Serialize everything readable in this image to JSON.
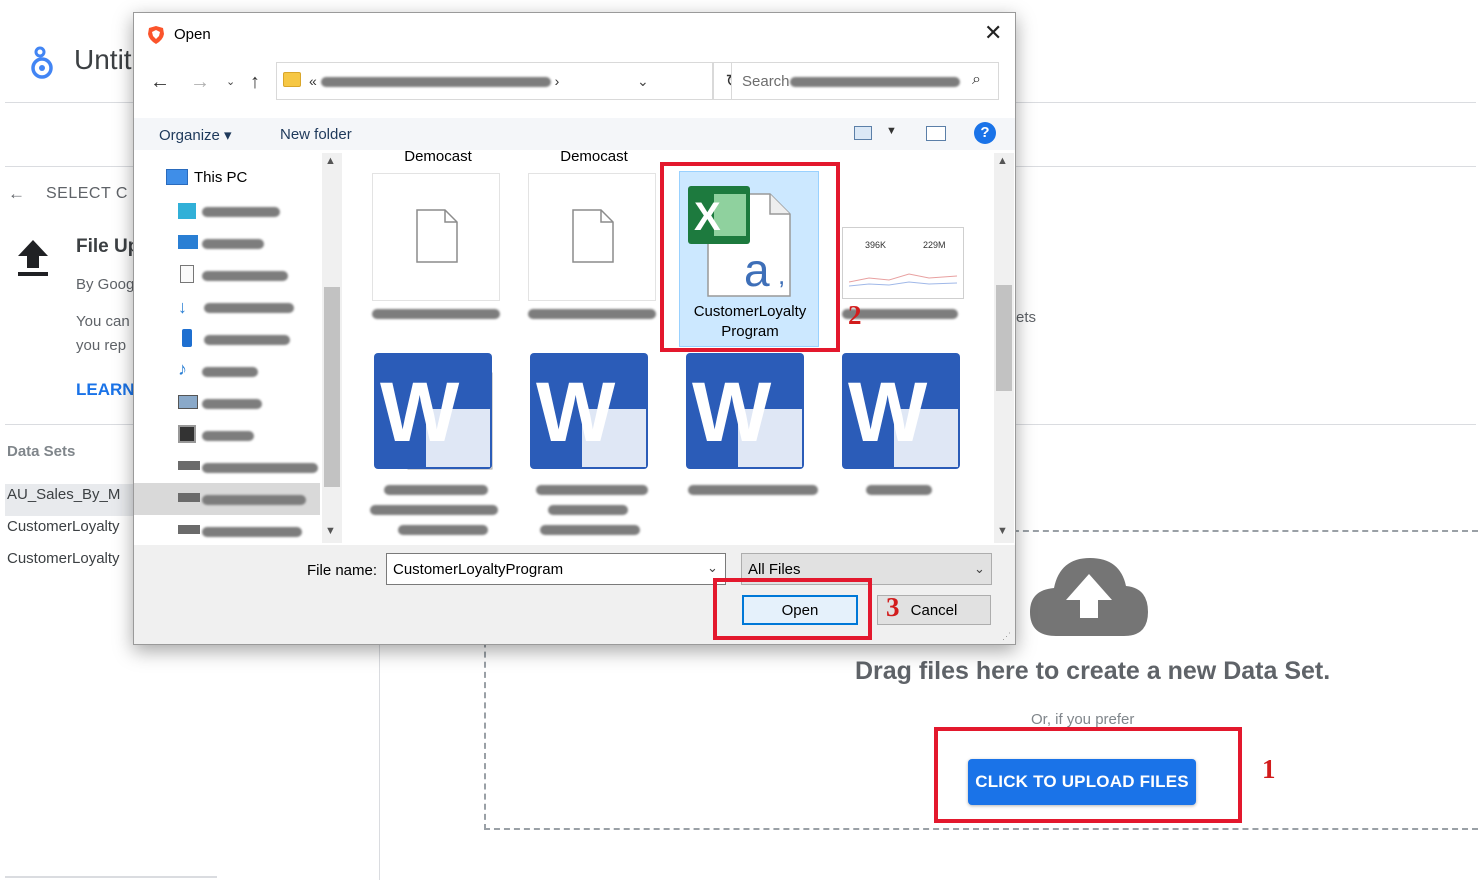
{
  "app": {
    "title": "Untit",
    "back_label": "SELECT C",
    "connector_title": "File Up",
    "connector_by": "By Goog",
    "connector_desc_1": "You can",
    "connector_desc_2": "you rep",
    "learn_label": "LEARN",
    "datasets_header": "Data Sets",
    "datasets": [
      "AU_Sales_By_M",
      "CustomerLoyalty",
      "CustomerLoyalty"
    ],
    "right_text_fragment": "ets",
    "drag_text": "Drag files here to create a new Data Set.",
    "or_text": "Or, if you prefer",
    "upload_button": "CLICK TO UPLOAD FILES"
  },
  "dialog": {
    "title": "Open",
    "address_prefix": "«",
    "search_placeholder": "Search",
    "organize": "Organize ▾",
    "new_folder": "New folder",
    "tree": {
      "this_pc": "This PC"
    },
    "partial_labels": [
      "Democast",
      "Democast"
    ],
    "selected_file": {
      "line1": "CustomerLoyalty",
      "line2": "Program"
    },
    "thumb_stats": [
      "396K",
      "229M"
    ],
    "file_name_label": "File name:",
    "file_name_value": "CustomerLoyaltyProgram",
    "file_type_value": "All Files",
    "open_button": "Open",
    "cancel_button": "Cancel"
  },
  "annotations": {
    "step1": "1",
    "step2": "2",
    "step3": "3",
    "color": "#e3182d"
  }
}
